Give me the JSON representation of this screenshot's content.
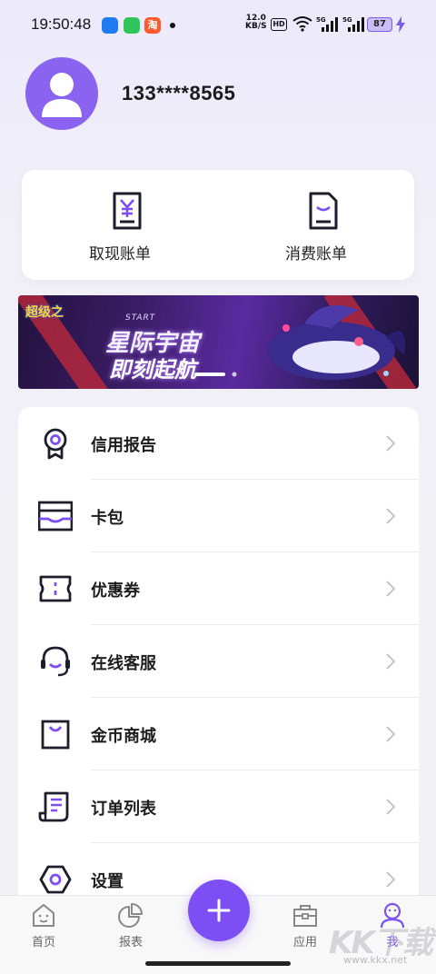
{
  "status_bar": {
    "time": "19:50:48",
    "app3_glyph": "淘",
    "net_speed_value": "12.0",
    "net_speed_unit": "KB/S",
    "hd_label": "HD",
    "sig1_label": "5G",
    "sig2_label": "5G",
    "battery": "87"
  },
  "profile": {
    "username": "133****8565"
  },
  "bills": {
    "withdraw_label": "取现账单",
    "consume_label": "消费账单"
  },
  "banner": {
    "logo_text": "超级之",
    "start_text": "START",
    "title_line1": "星际宇宙",
    "title_line2": "即刻起航"
  },
  "menu": [
    {
      "label": "信用报告",
      "icon": "ribbon-icon"
    },
    {
      "label": "卡包",
      "icon": "card-wallet-icon"
    },
    {
      "label": "优惠券",
      "icon": "coupon-icon"
    },
    {
      "label": "在线客服",
      "icon": "headset-icon"
    },
    {
      "label": "金币商城",
      "icon": "shopping-bag-icon"
    },
    {
      "label": "订单列表",
      "icon": "order-list-icon"
    },
    {
      "label": "设置",
      "icon": "settings-hex-icon"
    }
  ],
  "nav": {
    "home": "首页",
    "report": "报表",
    "apps": "应用",
    "me": "我"
  },
  "watermark": {
    "text": "KK下载",
    "url": "www.kkx.net"
  },
  "colors": {
    "accent": "#7c4ef4",
    "avatar": "#8a63f0",
    "battery_fill": "#c9bdf6"
  }
}
